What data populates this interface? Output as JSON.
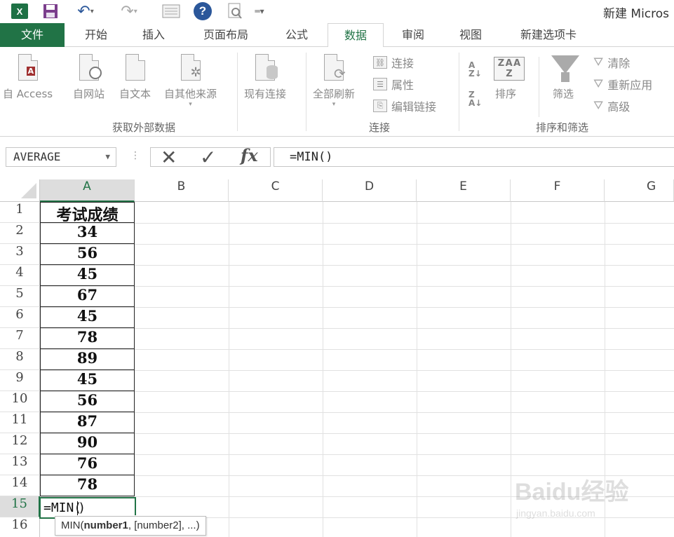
{
  "window": {
    "title": "新建 Micros"
  },
  "tabs": [
    {
      "label": "文件"
    },
    {
      "label": "开始"
    },
    {
      "label": "插入"
    },
    {
      "label": "页面布局"
    },
    {
      "label": "公式"
    },
    {
      "label": "数据"
    },
    {
      "label": "审阅"
    },
    {
      "label": "视图"
    },
    {
      "label": "新建选项卡"
    }
  ],
  "active_tab": "数据",
  "ribbon": {
    "get_external": {
      "group_label": "获取外部数据",
      "buttons": [
        "自 Access",
        "自网站",
        "自文本",
        "自其他来源",
        "现有连接"
      ]
    },
    "connections": {
      "group_label": "连接",
      "refresh_all": "全部刷新",
      "items": [
        "连接",
        "属性",
        "编辑链接"
      ]
    },
    "sort_filter": {
      "group_label": "排序和筛选",
      "sort": "排序",
      "filter": "筛选",
      "items": [
        "清除",
        "重新应用",
        "高级"
      ]
    }
  },
  "formula_bar": {
    "name_box": "AVERAGE",
    "fx_label": "fx",
    "formula": "=MIN()"
  },
  "grid": {
    "columns": [
      "A",
      "B",
      "C",
      "D",
      "E",
      "F",
      "G"
    ],
    "selected_column": "A",
    "rows": [
      "1",
      "2",
      "3",
      "4",
      "5",
      "6",
      "7",
      "8",
      "9",
      "10",
      "11",
      "12",
      "13",
      "14",
      "15",
      "16"
    ],
    "selected_row": "15",
    "column_a": {
      "header": "考试成绩",
      "values": [
        "34",
        "56",
        "45",
        "67",
        "45",
        "78",
        "89",
        "45",
        "56",
        "87",
        "90",
        "76",
        "78"
      ]
    },
    "active_cell_text": "=MIN(",
    "active_cell_close": ")"
  },
  "tooltip": {
    "func": "MIN(",
    "arg1": "number1",
    "rest": ", [number2], ...)"
  },
  "colors": {
    "excel_green": "#217346",
    "file_tab": "#217346"
  },
  "watermark": {
    "text": "Baidu经验",
    "sub": "jingyan.baidu.com"
  }
}
